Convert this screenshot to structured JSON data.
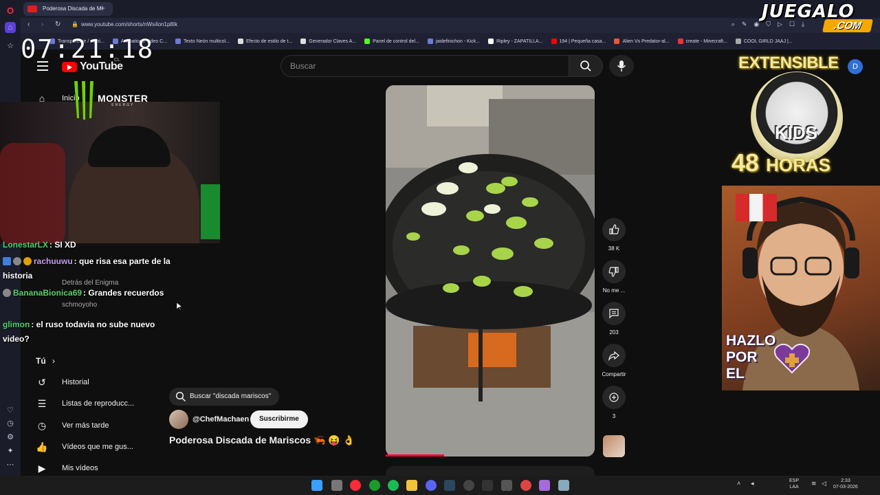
{
  "browser": {
    "tab_title": "Poderosa Discada de M",
    "new_tab_symbol": "+",
    "url": "www.youtube.com/shorts/nWs4on1p8Ik",
    "bookmarks": [
      "Transparente / semi...",
      "Animations Video C...",
      "Texto Neón multicol...",
      "Efecto de estilo de t...",
      "Generador Claves A...",
      "Panel de control del...",
      "jaidefinichon - Kick...",
      "Ripley - ZAPATILLA...",
      "194 | Pequeña casa...",
      "Alien Vs Predator-al...",
      "create - Minecraft...",
      "COOL GIRLD JAAJ |..."
    ]
  },
  "overlay": {
    "clock": "07:21:18",
    "brand_top": "JUEGALO",
    "brand_com": ".COM",
    "promo_top": "EXTENSIBLE",
    "promo_kids": "KIDS",
    "promo_hours_num": "48",
    "promo_hours_word": "HORAS",
    "hazlo_lines": [
      "HAZLO",
      "POR",
      "EL"
    ],
    "monster_name": "MONSTER",
    "monster_sub": "ENERGY"
  },
  "chat": [
    {
      "user": "LonestarLX",
      "msg": ": SI XD",
      "color": "#4fd16a"
    },
    {
      "user": "rachuuwu",
      "msg": ": que risa esa parte de la historia",
      "color": "#c89bf0"
    },
    {
      "user": "BananaBionica69",
      "msg": ": Grandes recuerdos",
      "color": "#5ad16a"
    },
    {
      "user": "glimon",
      "msg": ": el ruso todavia no sube nuevo video?",
      "color": "#4fd16a"
    }
  ],
  "youtube": {
    "logo_text": "YouTube",
    "country_code": "CL",
    "search_placeholder": "Buscar",
    "user_initial": "D",
    "sidebar": {
      "home_label": "Inicio",
      "sub_channel_1": "Detrás del Enigma",
      "sub_channel_2": "schmoyoho",
      "you_label": "Tú",
      "you_chevron": "›",
      "items": [
        {
          "label": "Historial",
          "icon": "history-icon"
        },
        {
          "label": "Listas de reproducc...",
          "icon": "playlist-icon"
        },
        {
          "label": "Ver más tarde",
          "icon": "watch-later-icon"
        },
        {
          "label": "Vídeos que me gus...",
          "icon": "like-icon"
        },
        {
          "label": "Mis vídeos",
          "icon": "my-videos-icon"
        }
      ]
    },
    "short": {
      "search_chip": "Buscar \"discada mariscos\"",
      "channel": "@ChefMachaen",
      "subscribe_label": "Suscribirme",
      "title": "Poderosa Discada de Mariscos 🦐 😝 👌",
      "progress": 0.28,
      "actions": {
        "like_count": "38 K",
        "dislike_label": "No me ...",
        "comments_count": "203",
        "share_label": "Compartir",
        "remix_count": "3"
      }
    }
  },
  "taskbar": {
    "lang_top": "ESP",
    "lang_bottom": "LAA",
    "time": "2:33",
    "date": "07-03-2026"
  },
  "colors": {
    "yt_red": "#ff0000",
    "progress_red": "#ff0033",
    "juegalo_orange": "#f5a800",
    "avatar_blue": "#2f6fd6"
  }
}
